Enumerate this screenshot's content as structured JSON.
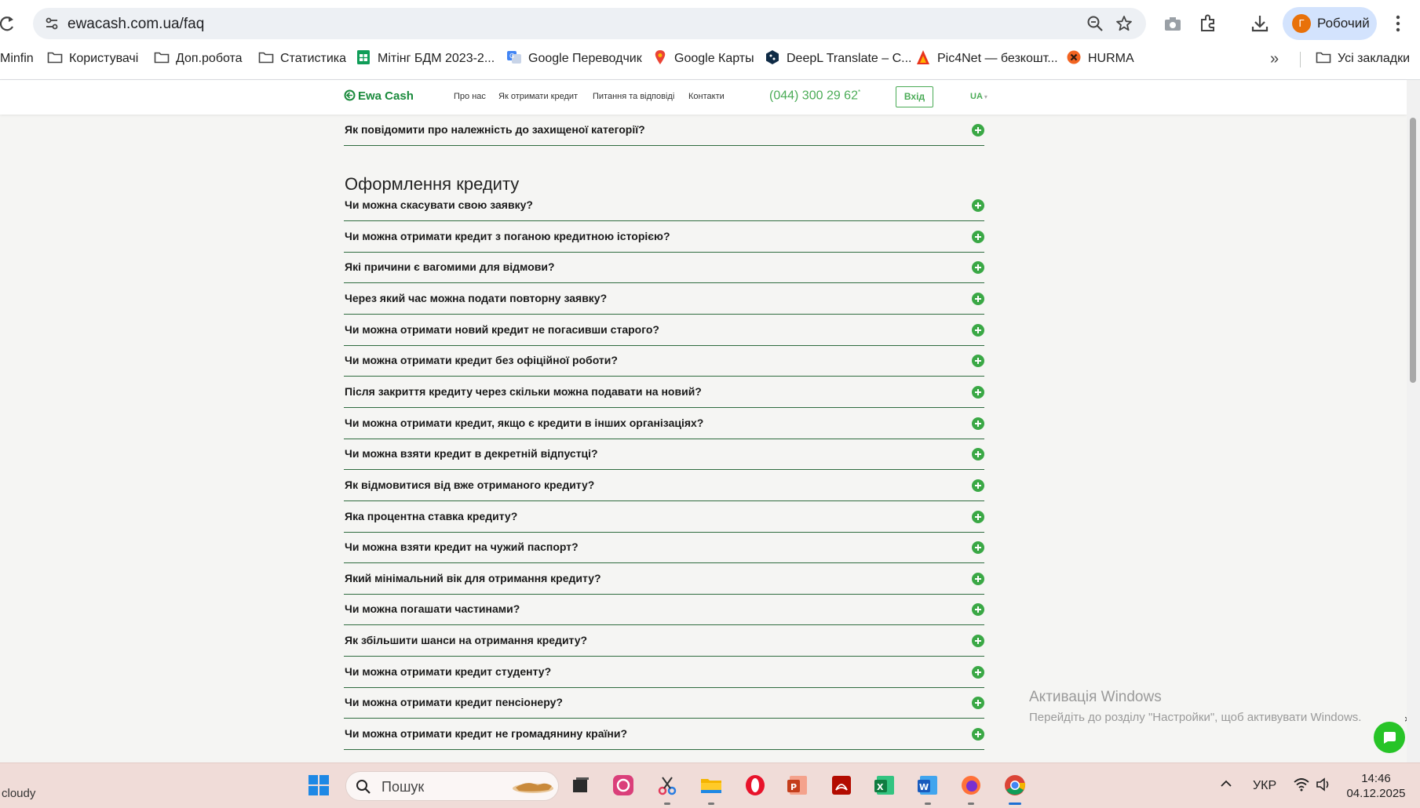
{
  "browser": {
    "url": "ewacash.com.ua/faq",
    "profile_initial": "Г",
    "profile_name": "Робочий",
    "bookmarks": [
      {
        "label": "Minfin",
        "icon": "none"
      },
      {
        "label": "Користувачі",
        "icon": "folder-icon"
      },
      {
        "label": "Доп.робота",
        "icon": "folder-icon"
      },
      {
        "label": "Статистика",
        "icon": "folder-icon"
      },
      {
        "label": "Мітінг БДМ 2023-2...",
        "icon": "sheets-icon"
      },
      {
        "label": "Google Переводчик",
        "icon": "translate-icon"
      },
      {
        "label": "Google Карты",
        "icon": "maps-icon"
      },
      {
        "label": "DeepL Translate – С...",
        "icon": "deepl-icon"
      },
      {
        "label": "Pic4Net — безкошт...",
        "icon": "pic4net-icon"
      },
      {
        "label": "HURMA",
        "icon": "hurma-icon"
      }
    ],
    "all_bookmarks": "Усі закладки"
  },
  "site": {
    "logo": "Ewa Cash",
    "nav": [
      "Про нас",
      "Як отримати кредит",
      "Питання та відповіді",
      "Контакти"
    ],
    "phone": "(044) 300 29 62",
    "phone_mark": "*",
    "login": "Вхід",
    "lang": "UA",
    "lang_caret": "▾"
  },
  "faq": {
    "top_item": "Як повідомити про належність до захищеної категорії?",
    "section_title": "Оформлення кредиту",
    "items": [
      "Чи можна скасувати свою заявку?",
      "Чи можна отримати кредит з поганою кредитною історією?",
      "Які причини є вагомими для відмови?",
      "Через який час можна подати повторну заявку?",
      "Чи можна отримати новий кредит не погасивши старого?",
      "Чи можна отримати кредит без офіційної роботи?",
      "Після закриття кредиту через скільки можна подавати на новий?",
      "Чи можна отримати кредит, якщо є кредити в інших організаціях?",
      "Чи можна взяти кредит в декретній відпустці?",
      "Як відмовитися від вже отриманого кредиту?",
      "Яка процентна ставка кредиту?",
      "Чи можна взяти кредит на чужий паспорт?",
      "Який мінімальний вік для отримання кредиту?",
      "Чи можна погашати частинами?",
      "Як збільшити шанси на отримання кредиту?",
      "Чи можна отримати кредит студенту?",
      "Чи можна отримати кредит пенсіонеру?",
      "Чи можна отримати кредит не громадянину країни?"
    ]
  },
  "windows_activation": {
    "title": "Активація Windows",
    "subtitle": "Перейдіть до розділу \"Настройки\", щоб активувати Windows."
  },
  "chat_close": "×",
  "taskbar": {
    "weather": "cloudy",
    "search_placeholder": "Пошук",
    "apps": [
      "task-view",
      "creative-cloud",
      "snipping-tool",
      "file-explorer",
      "opera",
      "powerpoint",
      "acrobat",
      "excel",
      "word",
      "firefox",
      "chrome"
    ],
    "language": "УКР",
    "time": "14:46",
    "date": "04.12.2025"
  },
  "colors": {
    "brand_green": "#4aab56",
    "divider_green": "#2e6b3e",
    "plus_green": "#3aa845",
    "chat_green": "#27c427"
  }
}
